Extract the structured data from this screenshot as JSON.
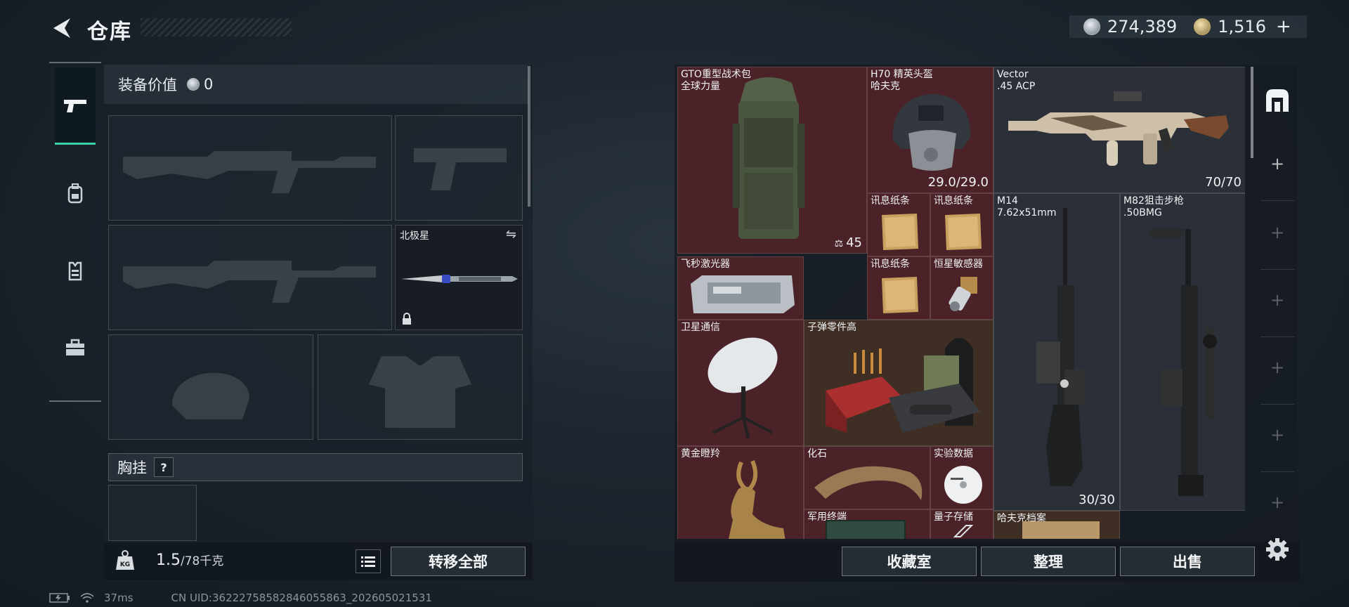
{
  "header": {
    "title": "仓库"
  },
  "currency": {
    "silver": "274,389",
    "gold": "1,516",
    "plus": "+"
  },
  "tabs": [
    {
      "name": "weapons",
      "icon": "pistol-icon"
    },
    {
      "name": "backpack",
      "icon": "backpack-icon"
    },
    {
      "name": "vest",
      "icon": "vest-icon"
    },
    {
      "name": "case",
      "icon": "briefcase-icon"
    }
  ],
  "equipment": {
    "value_label": "装备价值",
    "value": "0",
    "melee_name": "北极星",
    "chest_label": "胸挂",
    "chest_help": "?"
  },
  "footer_left": {
    "weight": "1.5",
    "weight_cap": "/78千克",
    "kg_icon_text": "KG",
    "transfer_all": "转移全部"
  },
  "items": [
    {
      "id": "backpack",
      "name": "GTO重型战术包\n全球力量",
      "count": "45",
      "bg": "red"
    },
    {
      "id": "helmet",
      "name": "H70 精英头盔\n哈夫克",
      "count": "29.0/29.0",
      "bg": "red"
    },
    {
      "id": "vector",
      "name": "Vector\n.45 ACP",
      "count": "70/70",
      "bg": "dark"
    },
    {
      "id": "note1",
      "name": "讯息纸条",
      "count": "",
      "bg": "red"
    },
    {
      "id": "note2",
      "name": "讯息纸条",
      "count": "",
      "bg": "red"
    },
    {
      "id": "m14",
      "name": "M14\n7.62x51mm",
      "count": "30/30",
      "bg": "dark"
    },
    {
      "id": "m82",
      "name": "M82狙击步枪\n.50BMG",
      "count": "",
      "bg": "dark"
    },
    {
      "id": "laser",
      "name": "飞秒激光器",
      "count": "",
      "bg": "red"
    },
    {
      "id": "note3",
      "name": "讯息纸条",
      "count": "",
      "bg": "red"
    },
    {
      "id": "sensor",
      "name": "恒星敏感器",
      "count": "",
      "bg": "red"
    },
    {
      "id": "satcom",
      "name": "卫星通信",
      "count": "",
      "bg": "red"
    },
    {
      "id": "ammo",
      "name": "子弹零件高",
      "count": "",
      "bg": "brown"
    },
    {
      "id": "deer",
      "name": "黄金瞪羚",
      "count": "",
      "bg": "red"
    },
    {
      "id": "fossil",
      "name": "化石",
      "count": "",
      "bg": "red"
    },
    {
      "id": "data",
      "name": "实验数据",
      "count": "",
      "bg": "red"
    },
    {
      "id": "mil",
      "name": "军用终端",
      "count": "",
      "bg": "red"
    },
    {
      "id": "quantum",
      "name": "量子存储",
      "count": "",
      "bg": "red"
    },
    {
      "id": "archive",
      "name": "哈夫克档案",
      "count": "",
      "bg": "brown"
    }
  ],
  "footer_right": {
    "collection": "收藏室",
    "organize": "整理",
    "sell": "出售"
  },
  "status": {
    "ping": "37ms",
    "uid": "CN UID:36222758582846055863_202605021531"
  }
}
